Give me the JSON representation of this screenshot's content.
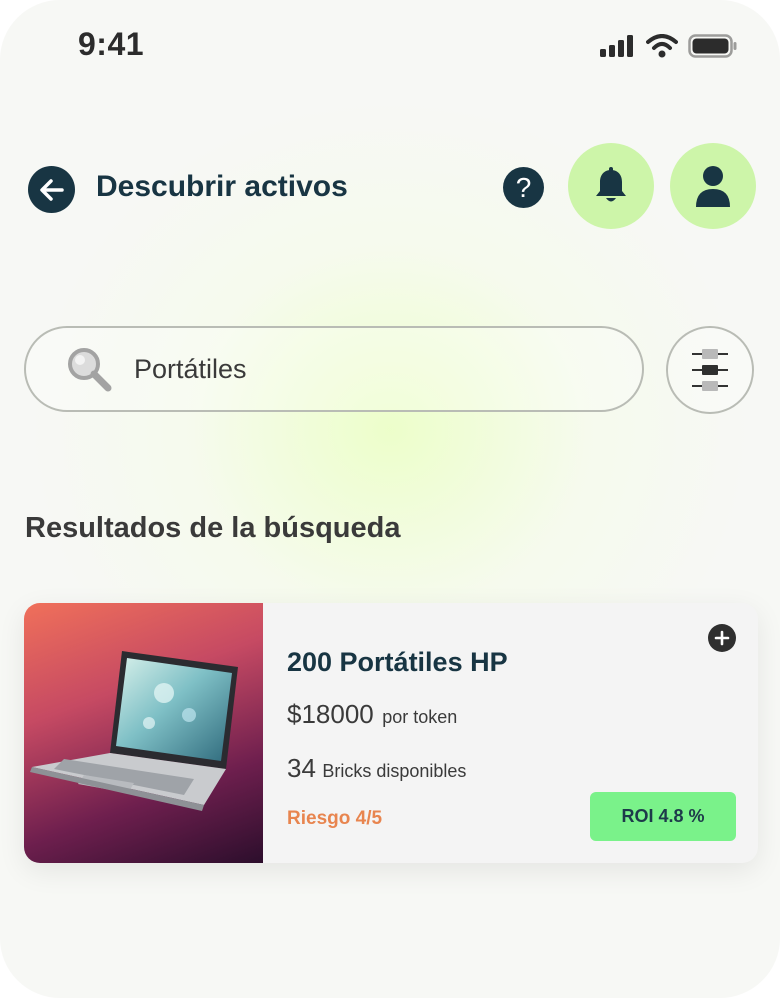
{
  "status_bar": {
    "time": "9:41",
    "icons": [
      "signal-icon",
      "wifi-icon",
      "battery-icon"
    ]
  },
  "header": {
    "title": "Descubrir activos",
    "back_icon": "arrow-left-icon",
    "help_icon": "question-icon",
    "notification_icon": "bell-icon",
    "profile_icon": "user-icon"
  },
  "search": {
    "value": "Portátiles",
    "icon": "search-icon",
    "filter_icon": "sliders-icon"
  },
  "results": {
    "title": "Resultados de la búsqueda",
    "items": [
      {
        "title": "200 Portátiles HP",
        "price": "$18000",
        "price_unit": "por token",
        "bricks_count": "34",
        "bricks_label": "Bricks disponibles",
        "risk": "Riesgo 4/5",
        "roi": "ROI 4.8 %",
        "image": "laptop-image",
        "add_icon": "plus-circle-icon"
      }
    ]
  },
  "colors": {
    "primary_dark": "#183543",
    "accent_green": "#cdf5a9",
    "roi_green": "#7af28a",
    "risk_orange": "#e8854f"
  }
}
